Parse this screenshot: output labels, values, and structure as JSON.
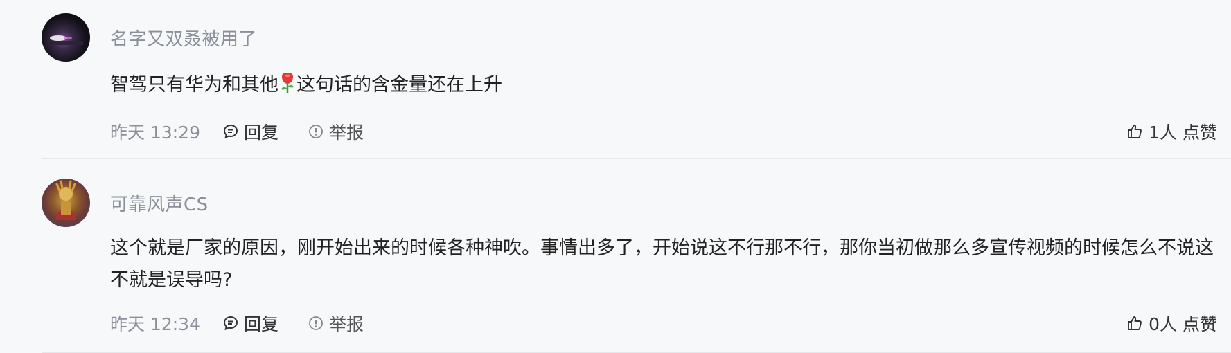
{
  "comments": [
    {
      "username": "名字又双叒被用了",
      "content_before": "智驾只有华为和其他",
      "emoji": "rose-emoji",
      "content_after": "这句话的含金量还在上升",
      "time": "昨天 13:29",
      "reply_label": "回复",
      "report_label": "举报",
      "like_count": "1人",
      "like_label": "点赞"
    },
    {
      "username": "可靠风声CS",
      "content": "这个就是厂家的原因，刚开始出来的时候各种神吹。事情出多了，开始说这不行那不行，那你当初做那么多宣传视频的时候怎么不说这不就是误导吗?",
      "time": "昨天 12:34",
      "reply_label": "回复",
      "report_label": "举报",
      "like_count": "0人",
      "like_label": "点赞"
    }
  ],
  "colors": {
    "background": "#f7f8fa",
    "muted_text": "#8a8f99",
    "body_text": "#222222",
    "divider": "#e5e7eb"
  }
}
